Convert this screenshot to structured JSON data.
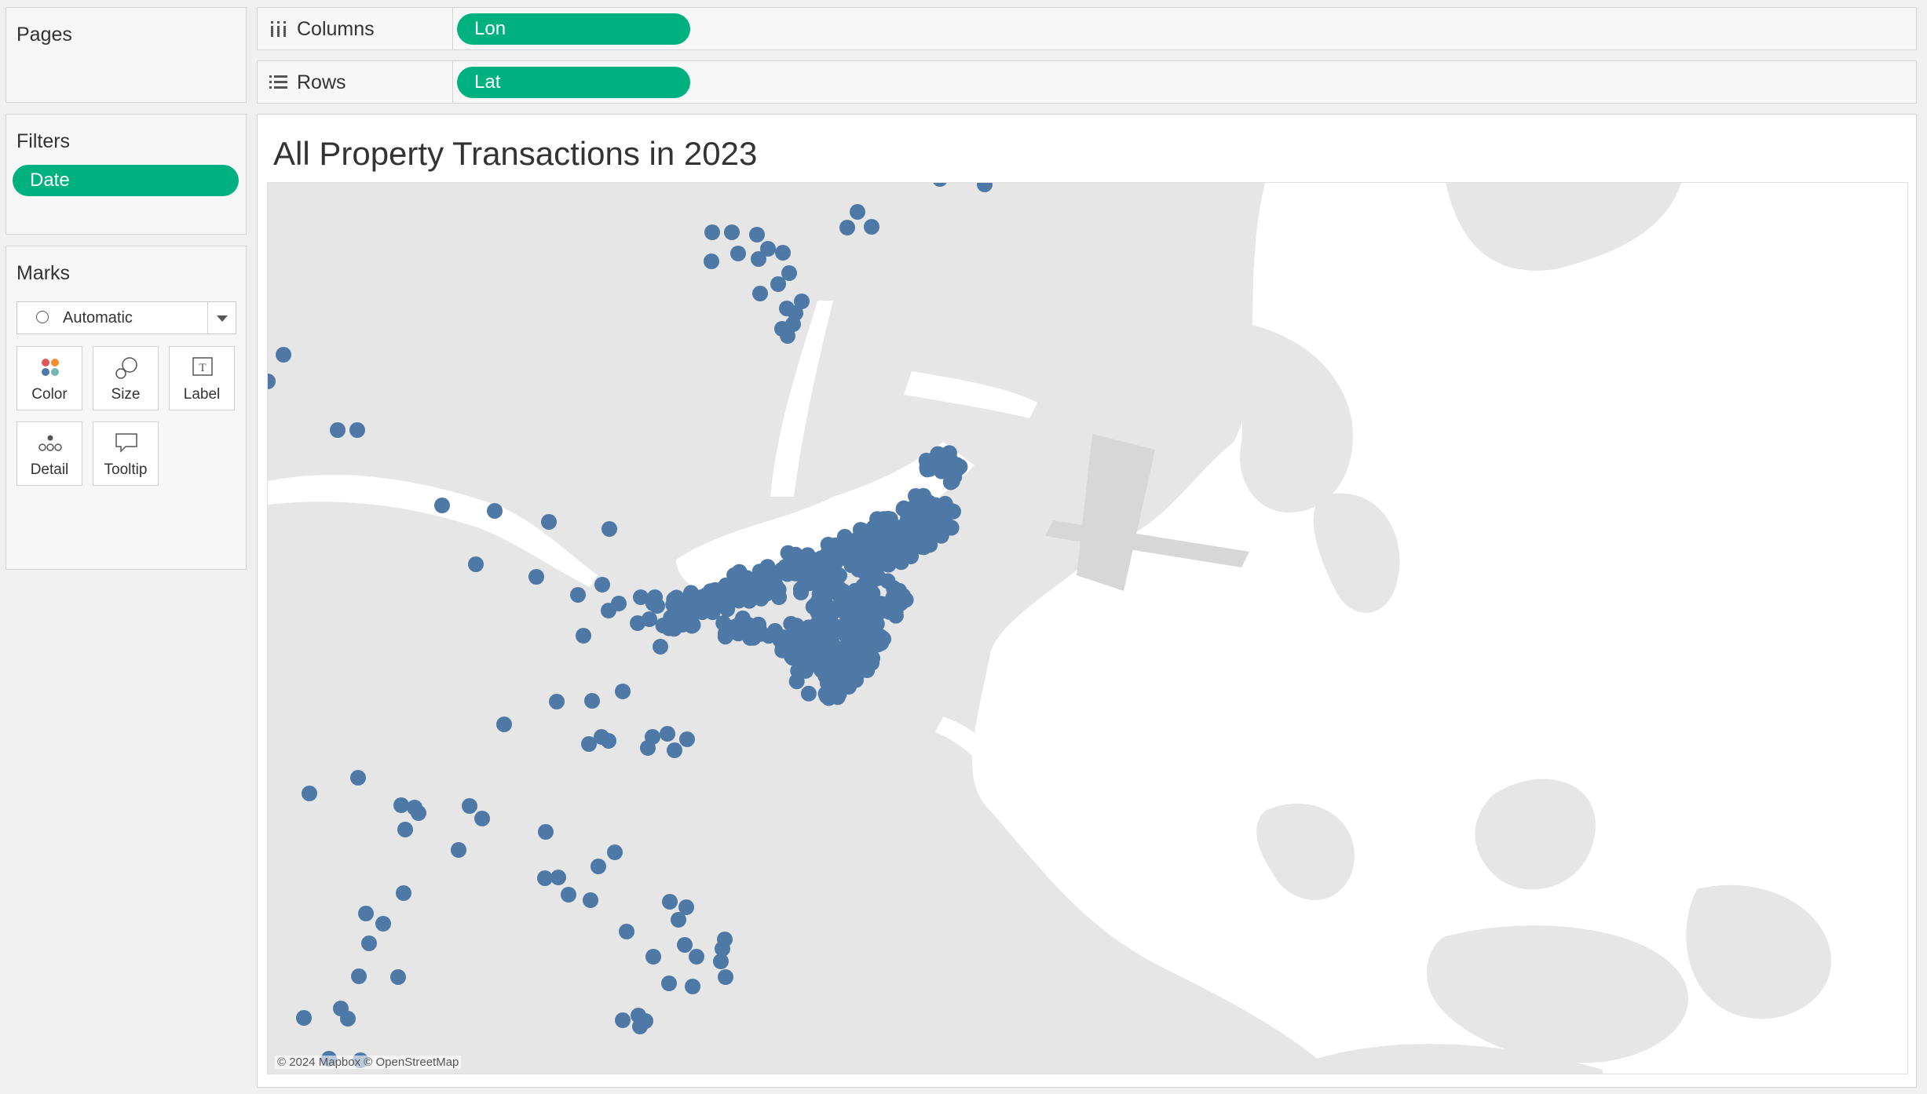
{
  "pages": {
    "title": "Pages"
  },
  "filters": {
    "title": "Filters",
    "items": [
      "Date"
    ]
  },
  "marks": {
    "title": "Marks",
    "mark_type": "Automatic",
    "buttons": [
      "Color",
      "Size",
      "Label",
      "Detail",
      "Tooltip"
    ]
  },
  "shelves": {
    "columns_label": "Columns",
    "columns_pill": "Lon",
    "rows_label": "Rows",
    "rows_pill": "Lat"
  },
  "viz": {
    "title": "All Property Transactions in 2023",
    "attribution": "© 2024 Mapbox © OpenStreetMap"
  },
  "colors": {
    "pill": "#00b180",
    "mark": "#4e79a7",
    "land": "#e6e6e6",
    "water": "#ffffff"
  },
  "chart_data": {
    "type": "scatter",
    "title": "All Property Transactions in 2023",
    "mark_type": "circle",
    "mark_color": "#4e79a7"
  }
}
